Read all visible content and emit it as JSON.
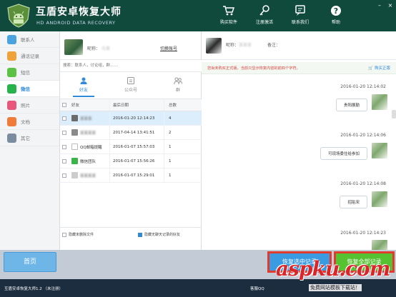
{
  "app": {
    "title": "互盾安卓恢复大师",
    "subtitle": "HD ANDROID DATA RECOVERY"
  },
  "header_buttons": [
    {
      "label": "购买软件",
      "icon": "cart-icon"
    },
    {
      "label": "注册激活",
      "icon": "key-icon"
    },
    {
      "label": "联系我们",
      "icon": "chat-icon"
    },
    {
      "label": "帮助",
      "icon": "help-icon"
    }
  ],
  "window_controls": [
    "–",
    "×"
  ],
  "nav": [
    {
      "label": "联系人",
      "color": "#4aa3df"
    },
    {
      "label": "通话记录",
      "color": "#f0a23a"
    },
    {
      "label": "短信",
      "color": "#5cc246"
    },
    {
      "label": "微信",
      "color": "#27b24b",
      "active": true
    },
    {
      "label": "照片",
      "color": "#e9567c"
    },
    {
      "label": "文档",
      "color": "#f07b3a"
    },
    {
      "label": "其它",
      "color": "#7a8c9e"
    }
  ],
  "contact": {
    "nick_label": "昵称：",
    "nick_value": "与某",
    "switch_label": "切换账号"
  },
  "search": {
    "placeholder": "搜索：联系人，讨论组，群……"
  },
  "subtabs": [
    {
      "label": "好友",
      "active": true
    },
    {
      "label": "公众号"
    },
    {
      "label": "群"
    }
  ],
  "table": {
    "headers": [
      "好友",
      "最后日期",
      "总数"
    ],
    "rows": [
      {
        "name": "某某某",
        "date": "2016-01-20 12:14:23",
        "count": "4",
        "selected": true,
        "av": "#6b6b6b",
        "blur": true
      },
      {
        "name": "某某某某",
        "date": "2017-04-14 13:41:51",
        "count": "2",
        "av": "#8a8a8a",
        "blur": true
      },
      {
        "name": "QQ邮箱提醒",
        "date": "2016-01-07 15:57:03",
        "count": "1",
        "av": "#ffffff"
      },
      {
        "name": "微信团队",
        "date": "2016-01-07 15:56:26",
        "count": "1",
        "av": "#3bb54a"
      },
      {
        "name": "某某某某",
        "date": "2016-01-07 15:29:01",
        "count": "1",
        "av": "#cccccc",
        "blur": true
      }
    ]
  },
  "mid_footer": {
    "opt1": "隐藏未删除文件",
    "opt2": "隐藏无聊天记录的好友"
  },
  "right": {
    "nick_label": "昵称：",
    "nick_value": "某某某",
    "remark_label": "备注：",
    "notice": "您尚未购买正式版，当前只显示恢复内容的前四个字符。",
    "buy_link": "购买正版"
  },
  "messages": [
    {
      "time": "2016-01-20 12:14:02",
      "text": "贵阳展勤"
    },
    {
      "time": "2016-01-20 12:14:06",
      "text": "可现场委住给参加"
    },
    {
      "time": "2016-01-20 12:14:08",
      "text": "招贴宋"
    },
    {
      "time": "2016-01-20 12:14:23",
      "text": ""
    }
  ],
  "bottom": {
    "home": "首页",
    "restore_selected": "恢复选中记录",
    "restore_all": "恢复全部记录"
  },
  "status": {
    "version": "互盾安卓恢复大师1.2 （未注册）",
    "cs": "客服QQ"
  },
  "watermark": {
    "big": "aspku.com",
    "small": "免费网站模板下载站！"
  }
}
